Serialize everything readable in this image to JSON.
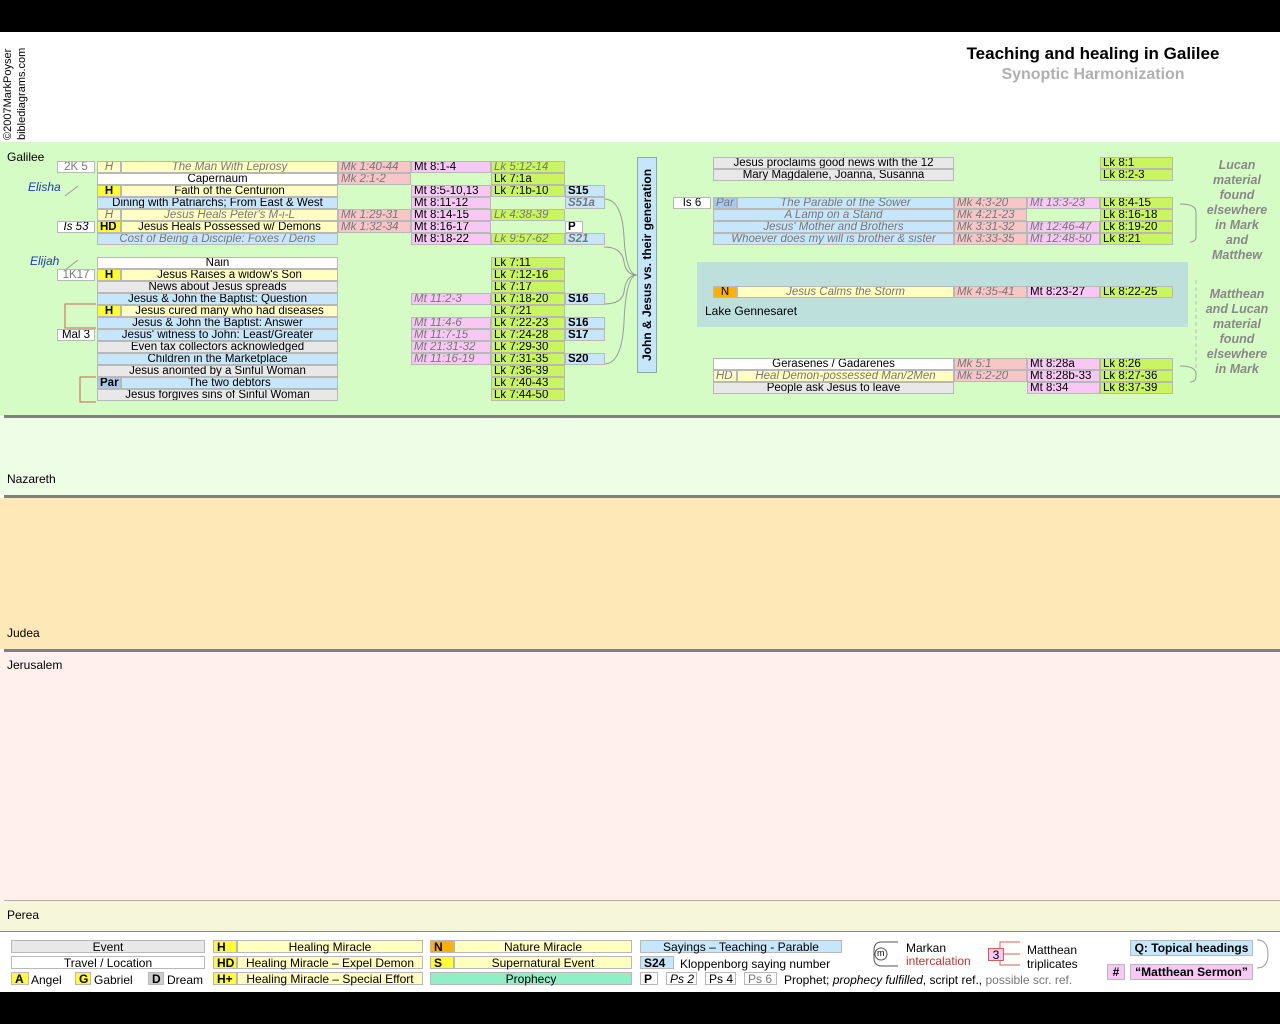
{
  "header": {
    "title": "Teaching and healing in Galilee",
    "subtitle": "Synoptic Harmonization",
    "copyright": "©2007MarkPoyser",
    "site": "biblediagrams.com"
  },
  "regions": {
    "galilee": "Galilee",
    "nazareth": "Nazareth",
    "judea": "Judea",
    "jerusalem": "Jerusalem",
    "perea": "Perea",
    "lake": "Lake Gennesaret"
  },
  "people": {
    "elisha": "Elisha",
    "elijah": "Elijah"
  },
  "vertical_label": "John & Jesus vs. their generation",
  "left_rows": [
    {
      "ot": "2K 5",
      "tag": "H",
      "event": "The Man With Leprosy",
      "mk": "Mk 1:40-44",
      "mt": "Mt 8:1-4",
      "lk": "Lk 5:12-14",
      "s": ""
    },
    {
      "ot": "",
      "tag": "",
      "event": "Capernaum",
      "mk": "Mk 2:1-2",
      "mt": "",
      "lk": "Lk 7:1a",
      "s": ""
    },
    {
      "ot": "",
      "tag": "H",
      "event": "Faith of the Centurion",
      "mk": "",
      "mt": "Mt 8:5-10,13",
      "lk": "Lk 7:1b-10",
      "s": "S15"
    },
    {
      "ot": "",
      "tag": "",
      "event": "Dining with Patriarchs; From East & West",
      "mk": "",
      "mt": "Mt 8:11-12",
      "lk": "",
      "s": "S51a"
    },
    {
      "ot": "",
      "tag": "H",
      "event": "Jesus Heals Peter's M-i-L",
      "mk": "Mk 1:29-31",
      "mt": "Mt 8:14-15",
      "lk": "Lk 4:38-39",
      "s": ""
    },
    {
      "ot": "Is 53",
      "tag": "HD",
      "event": "Jesus Heals Possessed w/ Demons",
      "mk": "Mk 1:32-34",
      "mt": "Mt 8:16-17",
      "lk": "",
      "s": "P"
    },
    {
      "ot": "",
      "tag": "",
      "event": "Cost of Being a Disciple: Foxes / Dens",
      "mk": "",
      "mt": "Mt 8:18-22",
      "lk": "Lk 9:57-62",
      "s": "S21"
    },
    {
      "ot": "",
      "tag": "",
      "event": "Nain",
      "mk": "",
      "mt": "",
      "lk": "Lk 7:11",
      "s": ""
    },
    {
      "ot": "1K17",
      "tag": "H",
      "event": "Jesus Raises a widow's Son",
      "mk": "",
      "mt": "",
      "lk": "Lk 7:12-16",
      "s": ""
    },
    {
      "ot": "",
      "tag": "",
      "event": "News about Jesus spreads",
      "mk": "",
      "mt": "",
      "lk": "Lk 7:17",
      "s": ""
    },
    {
      "ot": "",
      "tag": "",
      "event": "Jesus & John the Baptist: Question",
      "mk": "",
      "mt": "Mt 11:2-3",
      "lk": "Lk 7:18-20",
      "s": "S16"
    },
    {
      "ot": "",
      "tag": "H",
      "event": "Jesus cured many who had diseases",
      "mk": "",
      "mt": "",
      "lk": "Lk 7:21",
      "s": ""
    },
    {
      "ot": "",
      "tag": "",
      "event": "Jesus & John the Baptist: Answer",
      "mk": "",
      "mt": "Mt 11:4-6",
      "lk": "Lk 7:22-23",
      "s": "S16"
    },
    {
      "ot": "Mal 3",
      "tag": "",
      "event": "Jesus' witness to John: Least/Greater",
      "mk": "",
      "mt": "Mt 11:7-15",
      "lk": "Lk 7:24-28",
      "s": "S17"
    },
    {
      "ot": "",
      "tag": "",
      "event": "Even tax collectors acknowledged",
      "mk": "",
      "mt": "Mt 21:31-32",
      "lk": "Lk 7:29-30",
      "s": ""
    },
    {
      "ot": "",
      "tag": "",
      "event": "Children in the Marketplace",
      "mk": "",
      "mt": "Mt 11:16-19",
      "lk": "Lk 7:31-35",
      "s": "S20"
    },
    {
      "ot": "",
      "tag": "",
      "event": "Jesus anointed by a Sinful Woman",
      "mk": "",
      "mt": "",
      "lk": "Lk 7:36-39",
      "s": ""
    },
    {
      "ot": "",
      "tag": "Par",
      "event": "The two debtors",
      "mk": "",
      "mt": "",
      "lk": "Lk 7:40-43",
      "s": ""
    },
    {
      "ot": "",
      "tag": "",
      "event": "Jesus forgives sins of Sinful Woman",
      "mk": "",
      "mt": "",
      "lk": "Lk 7:44-50",
      "s": ""
    }
  ],
  "right_rows": [
    {
      "ot": "",
      "tag": "",
      "event": "Jesus proclaims good news with the 12",
      "mk": "",
      "mt": "",
      "lk": "Lk 8:1"
    },
    {
      "ot": "",
      "tag": "",
      "event": "Mary Magdalene, Joanna, Susanna",
      "mk": "",
      "mt": "",
      "lk": "Lk 8:2-3"
    },
    {
      "ot": "Is 6",
      "tag": "Par",
      "event": "The Parable of the Sower",
      "mk": "Mk 4:3-20",
      "mt": "Mt 13:3-23",
      "lk": "Lk 8:4-15"
    },
    {
      "ot": "",
      "tag": "",
      "event": "A Lamp on a Stand",
      "mk": "Mk 4:21-23",
      "mt": "",
      "lk": "Lk 8:16-18"
    },
    {
      "ot": "",
      "tag": "",
      "event": "Jesus' Mother and Brothers",
      "mk": "Mk 3:31-32",
      "mt": "Mt 12:46-47",
      "lk": "Lk 8:19-20"
    },
    {
      "ot": "",
      "tag": "",
      "event": "Whoever does my will is brother & sister",
      "mk": "Mk 3:33-35",
      "mt": "Mt 12:48-50",
      "lk": "Lk 8:21"
    },
    {
      "ot": "",
      "tag": "N",
      "event": "Jesus Calms the Storm",
      "mk": "Mk 4:35-41",
      "mt": "Mt 8:23-27",
      "lk": "Lk 8:22-25"
    },
    {
      "ot": "",
      "tag": "",
      "event": "Gerasenes / Gadarenes",
      "mk": "Mk 5:1",
      "mt": "Mt 8:28a",
      "lk": "Lk 8:26"
    },
    {
      "ot": "",
      "tag": "HD",
      "event": "Heal Demon-possessed Man/2Men",
      "mk": "Mk 5:2-20",
      "mt": "Mt 8:28b-33",
      "lk": "Lk 8:27-36"
    },
    {
      "ot": "",
      "tag": "",
      "event": "People ask Jesus to leave",
      "mk": "",
      "mt": "Mt 8:34",
      "lk": "Lk 8:37-39"
    }
  ],
  "notes": {
    "lucan": [
      "Lucan",
      "material",
      "found",
      "elsewhere",
      "in Mark",
      "and",
      "Matthew"
    ],
    "matthean": [
      "Matthean",
      "and Lucan",
      "material",
      "found",
      "elsewhere",
      "in Mark"
    ]
  },
  "legend": {
    "event": "Event",
    "travel": "Travel / Location",
    "angel_tag": "A",
    "angel": "Angel",
    "gabriel_tag": "G",
    "gabriel": "Gabriel",
    "dream_tag": "D",
    "dream": "Dream",
    "h_tag": "H",
    "healing": "Healing Miracle",
    "hd_tag": "HD",
    "expel": "Healing Miracle – Expel Demon",
    "hplus_tag": "H+",
    "special": "Healing Miracle – Special Effort",
    "n_tag": "N",
    "nature": "Nature Miracle",
    "s_tag": "S",
    "supernatural": "Supernatural Event",
    "prophecy": "Prophecy",
    "sayings": "Sayings – Teaching - Parable",
    "s24_tag": "S24",
    "klopp": "Kloppenborg saying number",
    "p_tag": "P",
    "ps2": "Ps 2",
    "ps4": "Ps 4",
    "ps6": "Ps 6",
    "prophet_a": "Prophet;",
    "prophet_b": "prophecy fulfilled",
    "prophet_c": ", script ref.,",
    "prophet_d": "possible scr. ref.",
    "markan_m": "m",
    "markan": "Markan",
    "intercalation": "intercalation",
    "trip_num": "3",
    "matthean": "Matthean",
    "triplicates": "triplicates",
    "q_heading": "Q: Topical headings",
    "hash": "#",
    "sermon": "“Matthean Sermon”"
  },
  "colors": {
    "galilee": "#d5fcc5",
    "nazareth": "#eefde5",
    "judea": "#ffe8b8",
    "jerusalem": "#fff0ed",
    "perea": "#f6f6da",
    "lake": "#bde0dc",
    "luke": "#c8f560",
    "matthew": "#f7c8f4",
    "mark": "#f7c6c6",
    "sayings": "#c6e6fb",
    "healing": "#ffffc0"
  }
}
